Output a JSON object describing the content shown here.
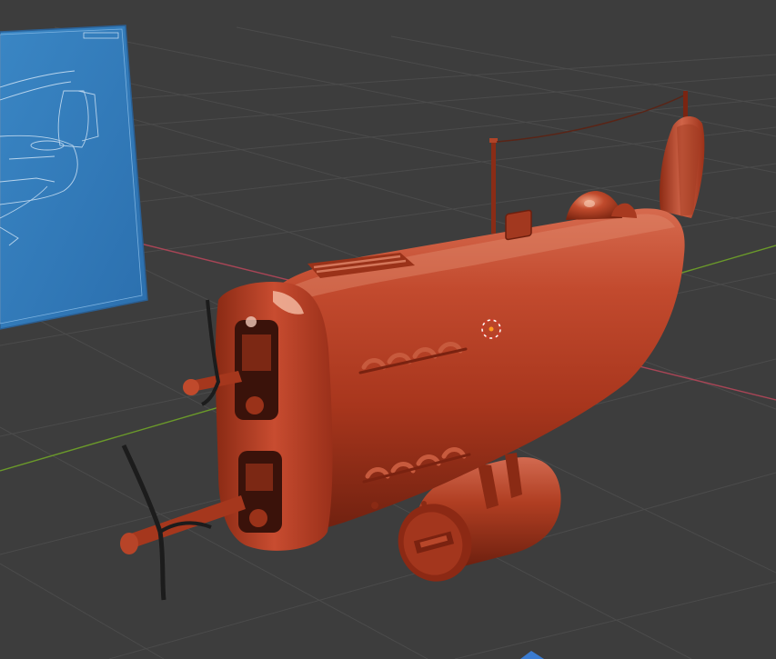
{
  "viewport": {
    "background": "#3d3d3d",
    "grid_color": "#4a4a4a",
    "axis_x_color": "#b04a5a",
    "axis_y_color": "#6e9a2a",
    "reference_image_color": "#2d78b8",
    "model_material_color": "#b53a20",
    "reference_image_label": "",
    "icons": {
      "object_origin": "3d-cursor-icon",
      "navigation": "navigation-gizmo-icon"
    }
  }
}
